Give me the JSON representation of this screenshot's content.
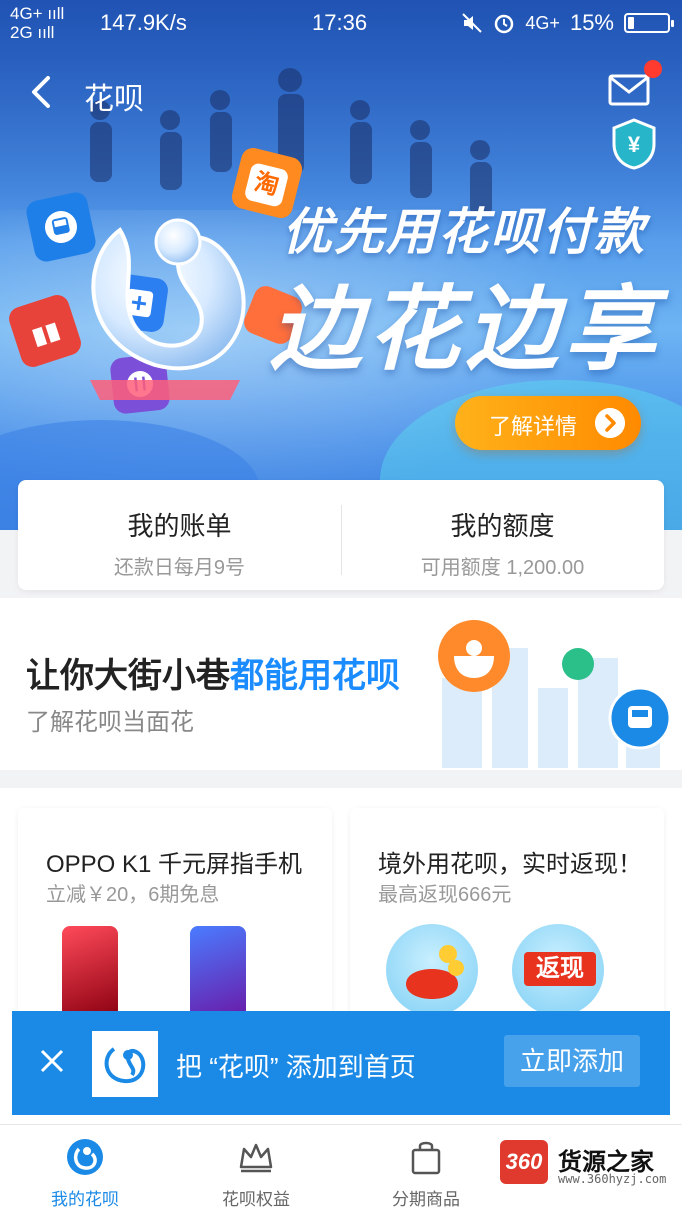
{
  "status_bar": {
    "net_line1": "4G+ ııll",
    "net_line2": "2G ııll",
    "speed": "147.9K/s",
    "time": "17:36",
    "net_right": "4G+",
    "battery_text": "15%",
    "battery_level": 0.15
  },
  "header": {
    "title": "花呗"
  },
  "banner": {
    "line1": "优先用花呗付款",
    "line2": "边花边享",
    "button": "了解详情",
    "cube_taobao": "淘"
  },
  "account": {
    "bill_title": "我的账单",
    "bill_sub": "还款日每月9号",
    "quota_title": "我的额度",
    "quota_sub": "可用额度 1,200.00"
  },
  "promo": {
    "title_plain": "让你大街小巷",
    "title_highlight": "都能用花呗",
    "subtitle": "了解花呗当面花"
  },
  "products": [
    {
      "title": "OPPO K1 千元屏指手机",
      "subtitle": "立减￥20，6期免息"
    },
    {
      "title": "境外用花呗，实时返现！",
      "subtitle": "最高返现666元",
      "badge": "返现"
    }
  ],
  "add_home": {
    "message": "把 “花呗” 添加到首页",
    "button": "立即添加"
  },
  "tabs": [
    {
      "label": "我的花呗",
      "active": true
    },
    {
      "label": "花呗权益",
      "active": false
    },
    {
      "label": "分期商品",
      "active": false
    }
  ],
  "watermark": {
    "badge": "360",
    "name": "货源之家",
    "url": "www.360hyzj.com"
  },
  "colors": {
    "accent": "#1a8ae6",
    "highlight": "#1a8cff",
    "orange": "#ff8a00",
    "badge_red": "#ff3b30"
  }
}
